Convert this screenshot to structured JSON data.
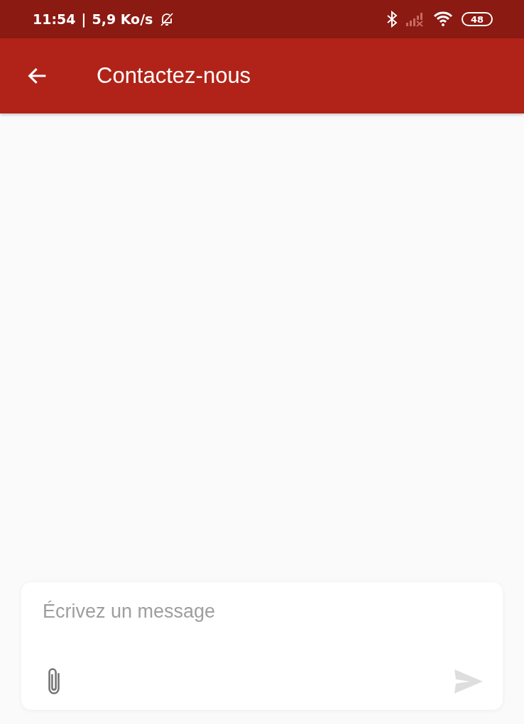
{
  "status_bar": {
    "time": "11:54",
    "separator": "|",
    "speed": "5,9 Ko/s",
    "battery": "48"
  },
  "app_bar": {
    "title": "Contactez-nous"
  },
  "composer": {
    "placeholder": "Écrivez un message",
    "send": {
      "disabled": true
    }
  }
}
